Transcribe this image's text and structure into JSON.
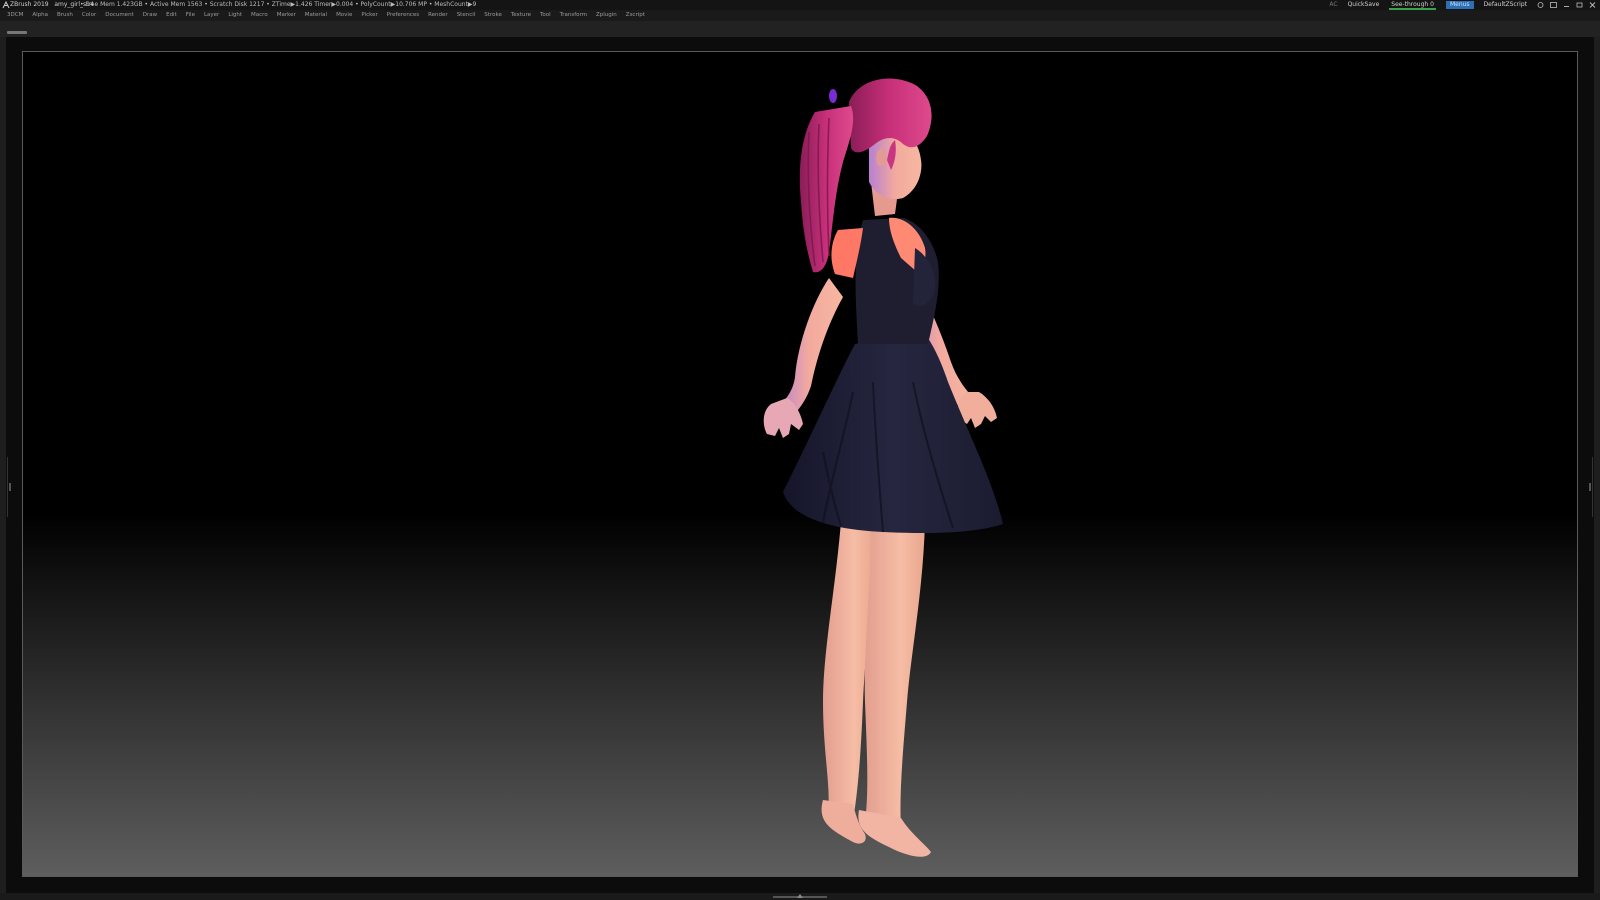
{
  "titlebar": {
    "app": "ZBrush 2019",
    "document": "amy_girl_s14",
    "stats": "• Free Mem 1.423GB • Active Mem 1563 • Scratch Disk 1217 • ZTime▶1.426 Timer▶0.004 • PolyCount▶10.706 MP • MeshCount▶9",
    "ac_label": "AC",
    "quicksave_label": "QuickSave",
    "seethrough_label": "See-through",
    "seethrough_value": "0",
    "menus_label": "Menus",
    "script_label": "DefaultZScript"
  },
  "menubar": {
    "items": [
      "3DCM",
      "Alpha",
      "Brush",
      "Color",
      "Document",
      "Draw",
      "Edit",
      "File",
      "Layer",
      "Light",
      "Macro",
      "Marker",
      "Material",
      "Movie",
      "Picker",
      "Preferences",
      "Render",
      "Stencil",
      "Stroke",
      "Texture",
      "Tool",
      "Transform",
      "Zplugin",
      "Zscript"
    ]
  },
  "colors": {
    "accent": "#2d6fb5",
    "seethrough_slider": "#3aa34a",
    "hair": "#c42a78",
    "ribbon": "#7a2bd4",
    "dress": "#1c1c2e",
    "skin": "#f0a8a0",
    "shirt": "#ff7868"
  },
  "icons": [
    "zbrush-logo-icon",
    "help-icon",
    "layout-icon",
    "minimize-icon",
    "restore-icon",
    "close-icon",
    "left-tray-handle-icon",
    "right-tray-handle-icon",
    "bottom-tray-handle-icon"
  ]
}
